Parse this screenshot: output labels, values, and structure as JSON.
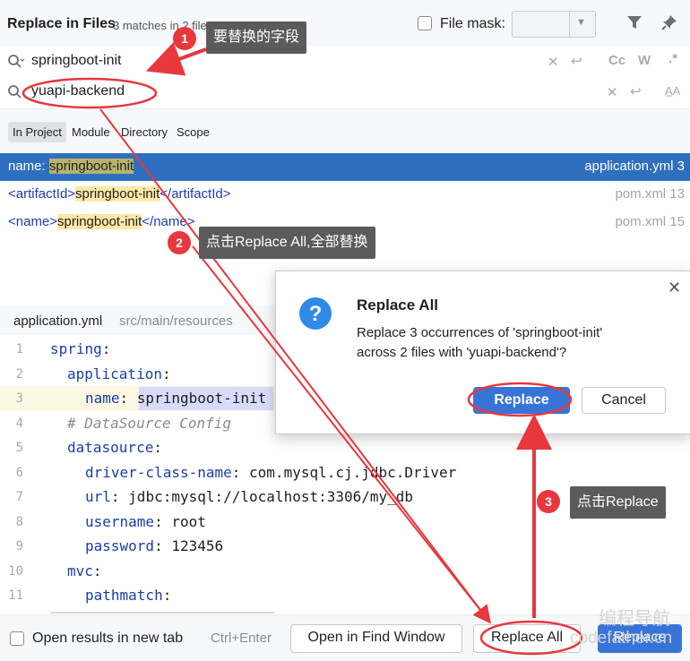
{
  "header": {
    "title": "Replace in Files",
    "matches": "3 matches in 2 files",
    "file_mask_label": "File mask:",
    "file_mask_value": ""
  },
  "search": {
    "value": "springboot-init"
  },
  "replace": {
    "value": "yuapi-backend"
  },
  "toggles": {
    "case": "Cc",
    "word": "W",
    "regex": ".*",
    "preserve_case": "A̲A"
  },
  "scope": {
    "tabs": [
      {
        "label": "In Project"
      },
      {
        "label": "Module"
      },
      {
        "label": "Directory"
      },
      {
        "label": "Scope"
      }
    ]
  },
  "results": [
    {
      "prefix": "name: ",
      "match": "springboot-init",
      "suffix": "",
      "location": "application.yml 3"
    },
    {
      "prefix_tag": "<artifactId>",
      "match": "springboot-init",
      "suffix_tag": "</artifactId>",
      "location": "pom.xml 13"
    },
    {
      "prefix_tag": "<name>",
      "match": "springboot-init",
      "suffix_tag": "</name>",
      "location": "pom.xml 15"
    }
  ],
  "editor": {
    "file": "application.yml",
    "path": "src/main/resources",
    "lines": [
      {
        "n": "1",
        "key": "spring",
        "sep": ":",
        "val": ""
      },
      {
        "n": "2",
        "key": "application",
        "sep": ":",
        "val": ""
      },
      {
        "n": "3",
        "key": "name",
        "sep": ": ",
        "val": "springboot-init"
      },
      {
        "n": "4",
        "comment": "# DataSource Config"
      },
      {
        "n": "5",
        "key": "datasource",
        "sep": ":",
        "val": ""
      },
      {
        "n": "6",
        "key": "driver-class-name",
        "sep": ": ",
        "val": "com.mysql.cj.jdbc.Driver"
      },
      {
        "n": "7",
        "key": "url",
        "sep": ": ",
        "val": "jdbc:mysql://localhost:3306/my_db"
      },
      {
        "n": "8",
        "key": "username",
        "sep": ": ",
        "val": "root"
      },
      {
        "n": "9",
        "key": "password",
        "sep": ": ",
        "val": "123456"
      },
      {
        "n": "10",
        "key": "mvc",
        "sep": ":",
        "val": ""
      },
      {
        "n": "11",
        "key": "pathmatch",
        "sep": ":",
        "val": ""
      }
    ]
  },
  "footer": {
    "open_new_label": "Open results in new tab",
    "shortcut": "Ctrl+Enter",
    "open_find_label": "Open in Find Window",
    "replace_all_label": "Replace All",
    "replace_label": "Replace"
  },
  "dialog": {
    "title": "Replace All",
    "message_line1": "Replace 3 occurrences of 'springboot-init'",
    "message_line2": "across 2 files with 'yuapi-backend'?",
    "replace_label": "Replace",
    "cancel_label": "Cancel"
  },
  "annotations": [
    {
      "n": "1",
      "text": "要替换的字段"
    },
    {
      "n": "2",
      "text": "点击Replace All,全部替换"
    },
    {
      "n": "3",
      "text": "点击Replace"
    }
  ],
  "watermark": {
    "line1": "编程导航",
    "line2": "codefather.cn"
  },
  "colors": {
    "accent": "#3874d8",
    "annotation_red": "#e8373d",
    "selected_row": "#2f6fbf"
  }
}
